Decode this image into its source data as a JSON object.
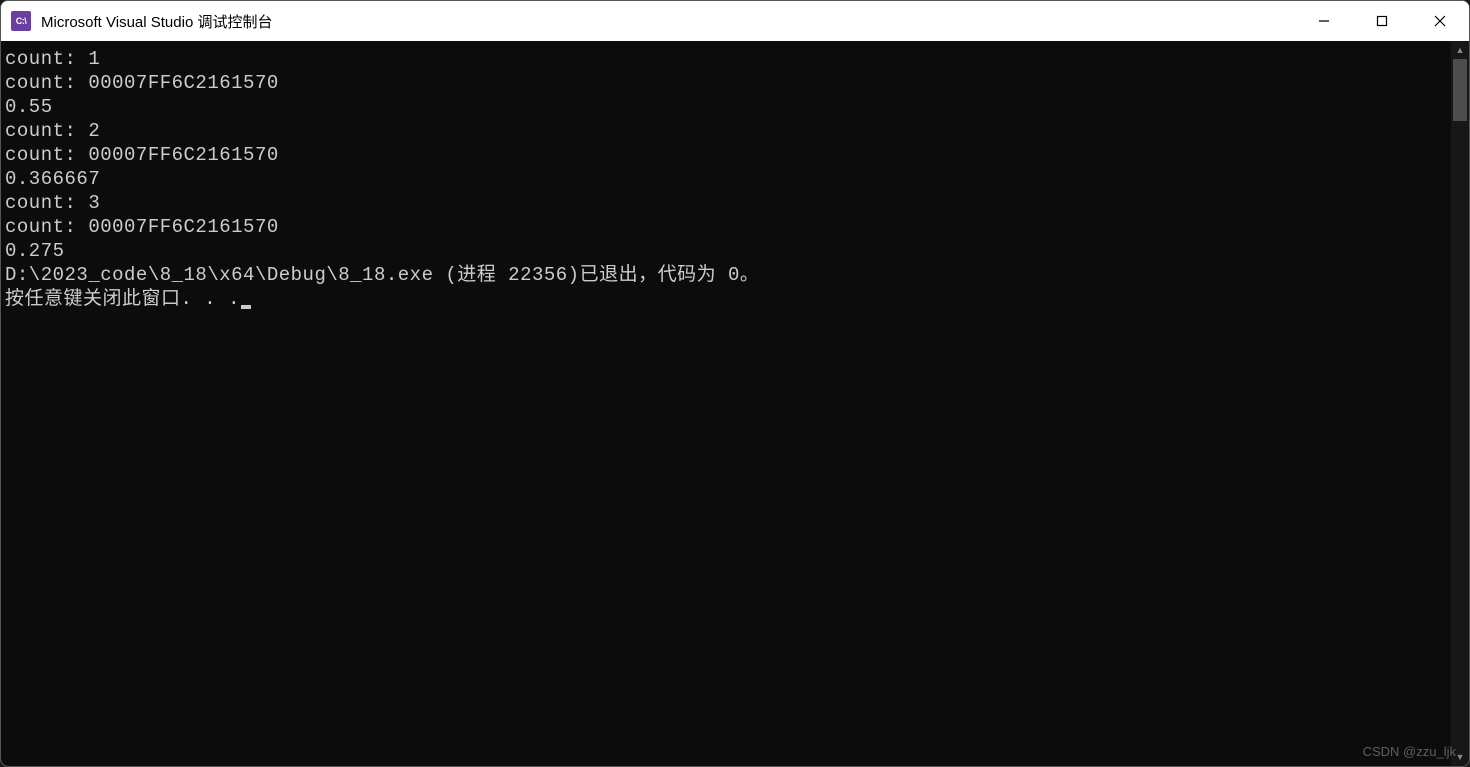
{
  "window": {
    "icon_label": "C:\\",
    "title": "Microsoft Visual Studio 调试控制台"
  },
  "console": {
    "lines": [
      "count: 1",
      "count: 00007FF6C2161570",
      "0.55",
      "count: 2",
      "count: 00007FF6C2161570",
      "0.366667",
      "count: 3",
      "count: 00007FF6C2161570",
      "0.275",
      "",
      "D:\\2023_code\\8_18\\x64\\Debug\\8_18.exe (进程 22356)已退出，代码为 0。",
      "按任意键关闭此窗口. . ."
    ]
  },
  "watermark": "CSDN @zzu_ljk"
}
